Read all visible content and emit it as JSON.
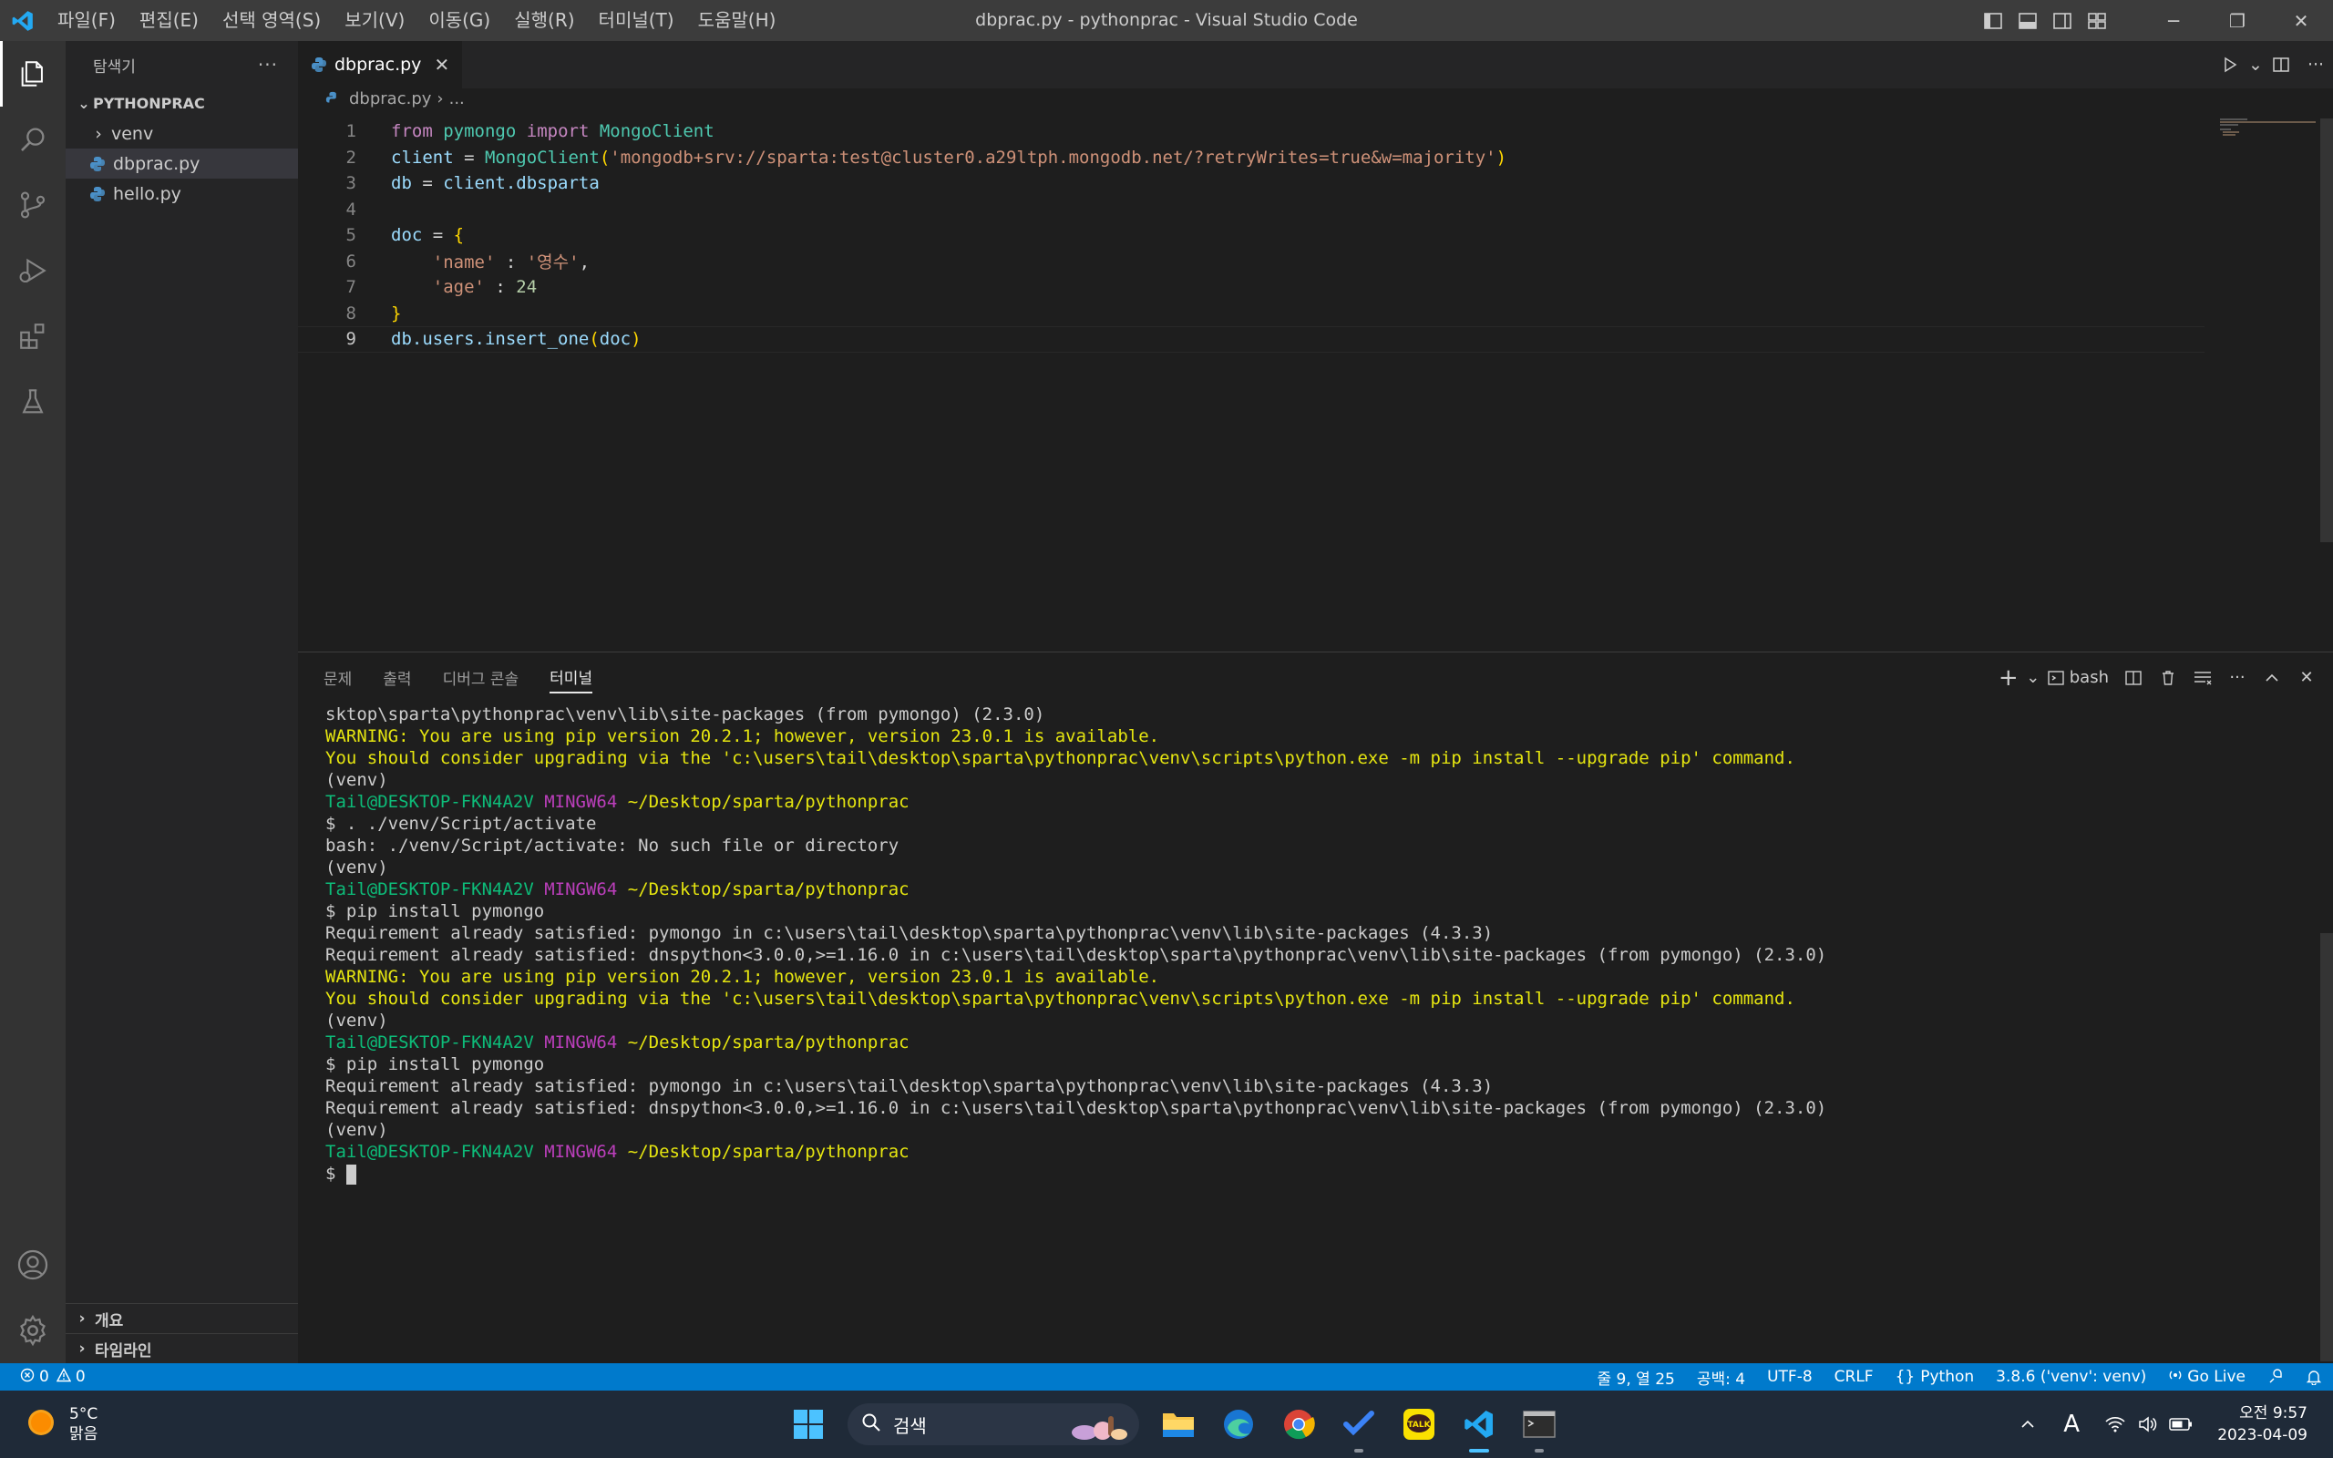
{
  "window": {
    "title": "dbprac.py - pythonprac - Visual Studio Code"
  },
  "menu": [
    "파일(F)",
    "편집(E)",
    "선택 영역(S)",
    "보기(V)",
    "이동(G)",
    "실행(R)",
    "터미널(T)",
    "도움말(H)"
  ],
  "sidebar": {
    "title": "탐색기",
    "project": "PYTHONPRAC",
    "items": [
      {
        "label": "venv",
        "type": "folder"
      },
      {
        "label": "dbprac.py",
        "type": "file"
      },
      {
        "label": "hello.py",
        "type": "file"
      }
    ],
    "outline": "개요",
    "timeline": "타임라인"
  },
  "editor": {
    "tab_label": "dbprac.py",
    "breadcrumb_file": "dbprac.py",
    "breadcrumb_more": "...",
    "line_numbers": [
      "1",
      "2",
      "3",
      "4",
      "5",
      "6",
      "7",
      "8",
      "9"
    ],
    "code": {
      "l1_kw1": "from",
      "l1_mod": "pymongo",
      "l1_kw2": "import",
      "l1_cls": "MongoClient",
      "l2_var": "client",
      "l2_eq": " = ",
      "l2_cls": "MongoClient",
      "l2_str": "'mongodb+srv://sparta:test@cluster0.a29ltph.mongodb.net/?retryWrites=true&w=majority'",
      "l3_var": "db",
      "l3_eq": " = ",
      "l3_expr": "client.dbsparta",
      "l5_var": "doc",
      "l5_eq": " = ",
      "l6_key": "'name'",
      "l6_sep": " : ",
      "l6_val": "'영수'",
      "l7_key": "'age'",
      "l7_sep": " : ",
      "l7_val": "24",
      "l9_expr": "db.users.insert_one",
      "l9_arg": "doc"
    }
  },
  "panel": {
    "tabs": [
      "문제",
      "출력",
      "디버그 콘솔",
      "터미널"
    ],
    "active_tab": "터미널",
    "shell_label": "bash",
    "terminal": {
      "l1": "sktop\\sparta\\pythonprac\\venv\\lib\\site-packages (from pymongo) (2.3.0)",
      "warn": "WARNING: You are using pip version 20.2.1; however, version 23.0.1 is available.",
      "consider": "You should consider upgrading via the 'c:\\users\\tail\\desktop\\sparta\\pythonprac\\venv\\scripts\\python.exe -m pip install --upgrade pip' command.",
      "venv": "(venv)",
      "user": "Tail@DESKTOP-FKN4A2V",
      "mingw": "MINGW64",
      "path": "~/Desktop/sparta/pythonprac",
      "cmd_activate": "$ . ./venv/Script/activate",
      "err_activate": "bash: ./venv/Script/activate: No such file or directory",
      "cmd_pip": "$ pip install pymongo",
      "req1": "Requirement already satisfied: pymongo in c:\\users\\tail\\desktop\\sparta\\pythonprac\\venv\\lib\\site-packages (4.3.3)",
      "req2": "Requirement already satisfied: dnspython<3.0.0,>=1.16.0 in c:\\users\\tail\\desktop\\sparta\\pythonprac\\venv\\lib\\site-packages (from pymongo) (2.3.0)",
      "prompt": "$ "
    }
  },
  "statusbar": {
    "errors": "0",
    "warnings": "0",
    "position": "줄 9, 열 25",
    "spaces": "공백: 4",
    "encoding": "UTF-8",
    "eol": "CRLF",
    "language": "Python",
    "interpreter": "3.8.6 ('venv': venv)",
    "golive": "Go Live"
  },
  "taskbar": {
    "temp": "5°C",
    "weather": "맑음",
    "search": "검색",
    "time": "오전 9:57",
    "date": "2023-04-09",
    "ime": "A"
  },
  "colors": {
    "accent": "#007acc",
    "titlebar": "#3c3c3c",
    "editor_bg": "#1e1e1e"
  }
}
